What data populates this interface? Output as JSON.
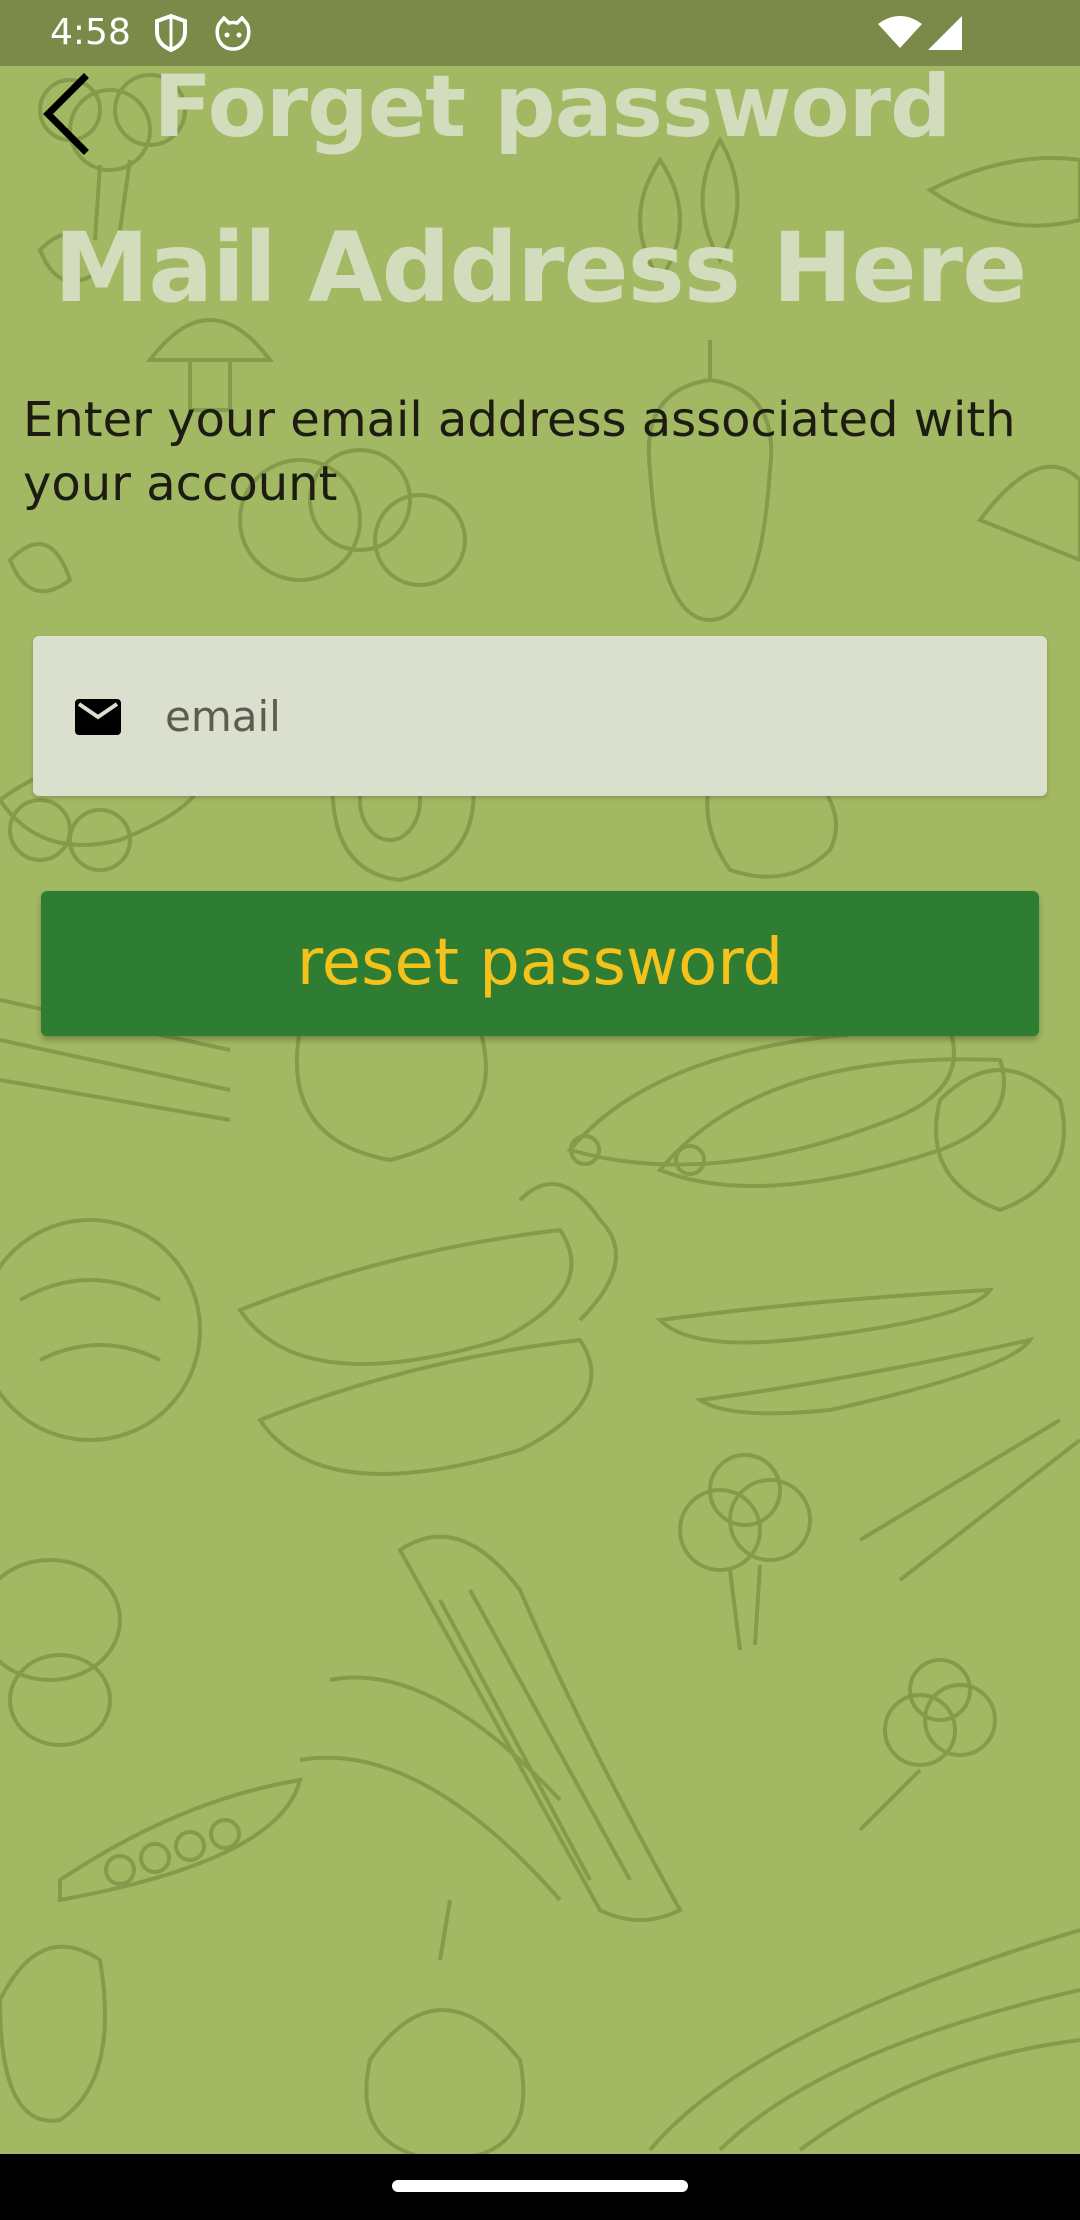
{
  "status_bar": {
    "time": "4:58",
    "icons": [
      "shield-icon",
      "cat-face-icon",
      "wifi-icon",
      "signal-icon"
    ]
  },
  "header": {
    "back_icon": "arrow-back-icon",
    "title": "Forget password",
    "subtitle": "Mail Address Here"
  },
  "main": {
    "description": "Enter your email address associated with your account",
    "email_field": {
      "icon": "mail-icon",
      "placeholder": "email",
      "value": ""
    },
    "reset_button": {
      "label": "reset password"
    }
  },
  "colors": {
    "background": "#a3b862",
    "status_bar": "#7b8a48",
    "title_text": "#d3dcbc",
    "field_bg": "#dbdfcd",
    "button_bg": "#2e7d32",
    "button_text": "#f5c21b"
  }
}
